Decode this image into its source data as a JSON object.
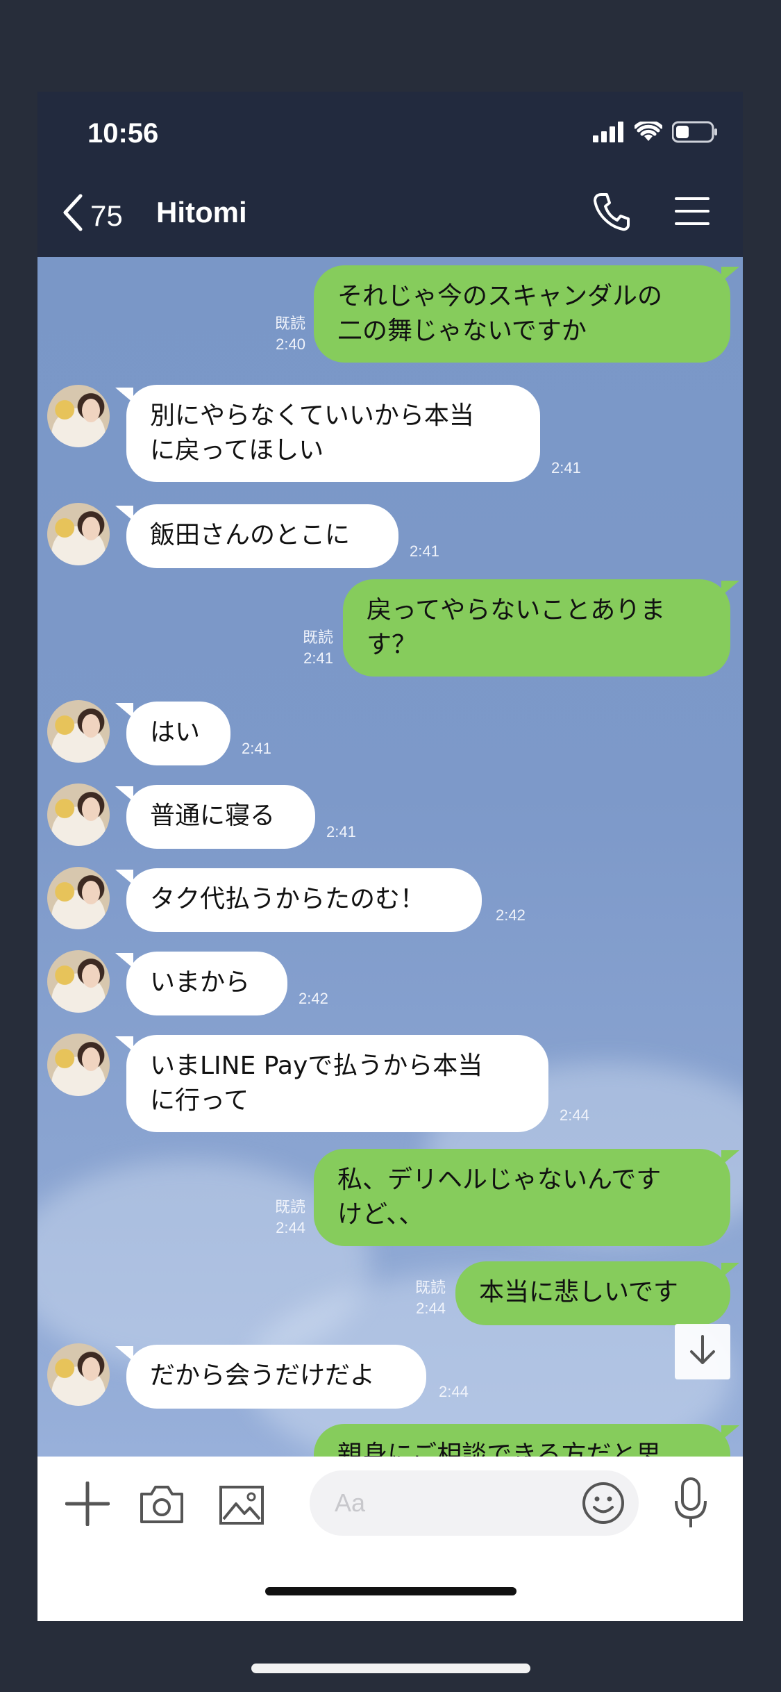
{
  "status": {
    "time": "10:56"
  },
  "header": {
    "back_count": "75",
    "title": "Hitomi"
  },
  "messages": [
    {
      "side": "out",
      "text": "それじゃ今のスキャンダルの\n二の舞じゃないですか",
      "read": "既読",
      "time": "2:40"
    },
    {
      "side": "in",
      "text": "別にやらなくていいから本当\nに戻ってほしい",
      "time": "2:41"
    },
    {
      "side": "in",
      "text": "飯田さんのとこに",
      "time": "2:41"
    },
    {
      "side": "out",
      "text": "戻ってやらないことありま\nす？",
      "read": "既読",
      "time": "2:41"
    },
    {
      "side": "in",
      "text": "はい",
      "time": "2:41"
    },
    {
      "side": "in",
      "text": "普通に寝る",
      "time": "2:41"
    },
    {
      "side": "in",
      "text": "タク代払うからたのむ！",
      "time": "2:42"
    },
    {
      "side": "in",
      "text": "いまから",
      "time": "2:42"
    },
    {
      "side": "in",
      "text": "いまLINE Payで払うから本当\nに行って",
      "time": "2:44"
    },
    {
      "side": "out",
      "text": "私、デリヘルじゃないんです\nけど、、",
      "read": "既読",
      "time": "2:44"
    },
    {
      "side": "out",
      "text": "本当に悲しいです",
      "read": "既読",
      "time": "2:44"
    },
    {
      "side": "in",
      "text": "だから会うだけだよ",
      "time": "2:44"
    },
    {
      "side": "out",
      "text": "親身にご相談できる方だと思",
      "read": "",
      "time": ""
    }
  ],
  "input": {
    "placeholder": "Aa"
  },
  "icons": {
    "back": "chevron-left-icon",
    "call": "phone-icon",
    "menu": "hamburger-menu-icon",
    "add": "plus-icon",
    "camera": "camera-icon",
    "image": "image-icon",
    "emoji": "smiley-icon",
    "mic": "microphone-icon",
    "scroll": "arrow-down-icon"
  },
  "colors": {
    "header_bg": "#222a3e",
    "chat_bg": "#7b97c8",
    "outgoing_bubble": "#86cc5c",
    "incoming_bubble": "#ffffff"
  }
}
